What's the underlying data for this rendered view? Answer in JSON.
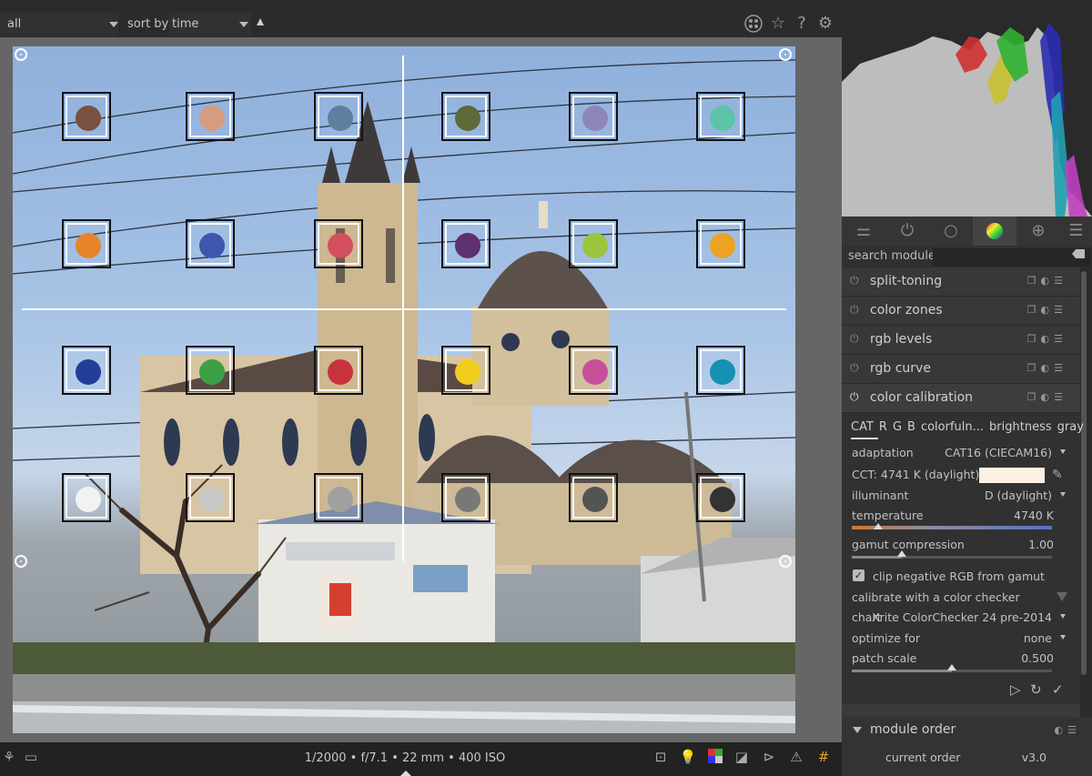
{
  "filter": {
    "collection": "all",
    "sort_label": "sort by",
    "sort_value": "time"
  },
  "top_icons": [
    "grouping-icon",
    "star-icon",
    "help-icon",
    "gear-icon"
  ],
  "exif": "1/2000 • f/7.1 • 22 mm • 400 ISO",
  "patches": [
    [
      "#7a5040",
      "#d69c80",
      "#5f7f9f",
      "#5c6a3a",
      "#8e86b8",
      "#5cc4a8"
    ],
    [
      "#e8822a",
      "#3f56ae",
      "#d4505e",
      "#5d3070",
      "#9cc43c",
      "#eda224"
    ],
    [
      "#233e9a",
      "#3da046",
      "#c8323c",
      "#f2cc1c",
      "#c6509a",
      "#1690b4"
    ],
    [
      "#f2f2f2",
      "#c8c8c8",
      "#a0a0a0",
      "#787878",
      "#545454",
      "#333333"
    ]
  ],
  "tabs": [
    "sliders-icon",
    "power-icon",
    "circle-icon",
    "color-wheel-icon",
    "palette-icon",
    "menu-icon"
  ],
  "search": {
    "label": "search module",
    "placeholder": ""
  },
  "modules": [
    {
      "name": "split-toning"
    },
    {
      "name": "color zones"
    },
    {
      "name": "rgb levels"
    },
    {
      "name": "rgb curve"
    },
    {
      "name": "color calibration"
    }
  ],
  "calibration": {
    "tabs": [
      "CAT",
      "R",
      "G",
      "B",
      "colorfuln...",
      "brightness",
      "gray"
    ],
    "adaptation_label": "adaptation",
    "adaptation_value": "CAT16 (CIECAM16)",
    "cct_label": "CCT: 4741 K (daylight)",
    "cct_swatch_color": "#fdf0e3",
    "illuminant_label": "illuminant",
    "illuminant_value": "D (daylight)",
    "temperature_label": "temperature",
    "temperature_value": "4740 K",
    "temperature_level": 0.13,
    "gamut_label": "gamut compression",
    "gamut_value": "1.00",
    "gamut_level": 0.25,
    "clip_label": "clip negative RGB from gamut",
    "clip_checked": true,
    "checker_label": "calibrate with a color checker",
    "chart_label": "chart",
    "chart_value": "Xrite ColorChecker 24 pre-2014",
    "optimize_label": "optimize for",
    "optimize_value": "none",
    "patch_scale_label": "patch scale",
    "patch_scale_value": "0.500",
    "patch_scale_level": 0.5
  },
  "module_order": {
    "header": "module order",
    "key": "current order",
    "value": "v3.0"
  }
}
